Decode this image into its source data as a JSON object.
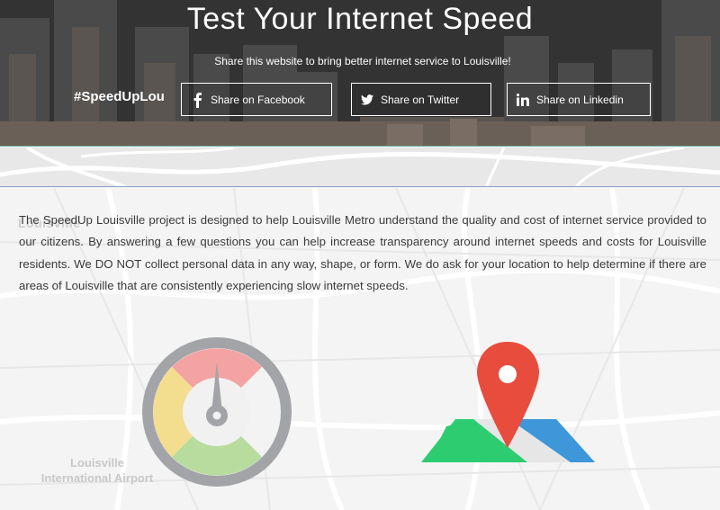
{
  "hero": {
    "title": "Test Your Internet Speed",
    "subtitle": "Share this website to bring better internet service to Louisville!",
    "hashtag": "#SpeedUpLou",
    "share_buttons": [
      {
        "label": "Share on Facebook",
        "icon": "facebook-icon"
      },
      {
        "label": "Share on Twitter",
        "icon": "twitter-icon"
      },
      {
        "label": "Share on Linkedin",
        "icon": "linkedin-icon"
      }
    ]
  },
  "main": {
    "intro": "The SpeedUp Louisville project is designed to help Louisville Metro understand the quality and cost of internet service provided to our citizens. By answering a few questions you can help increase transparency around internet speeds and costs for Louisville residents. We DO NOT collect personal data in any way, shape, or form. We do ask for your location to help determine if there are areas of Louisville that are consistently experiencing slow internet speeds.",
    "map_labels": {
      "city": "Louisville",
      "airport": "Louisville International Airport"
    },
    "icons": [
      "speedometer-icon",
      "map-pin-icon"
    ]
  },
  "colors": {
    "gauge_red": "#f4a3a3",
    "gauge_yellow": "#f3dd8e",
    "gauge_green": "#b8dc9e",
    "gauge_ring": "#a3a4a8",
    "pin_red": "#e84c3d",
    "map_blue": "#3d97d9",
    "map_green": "#2ecc71",
    "accent_line": "#6fb7a8"
  }
}
